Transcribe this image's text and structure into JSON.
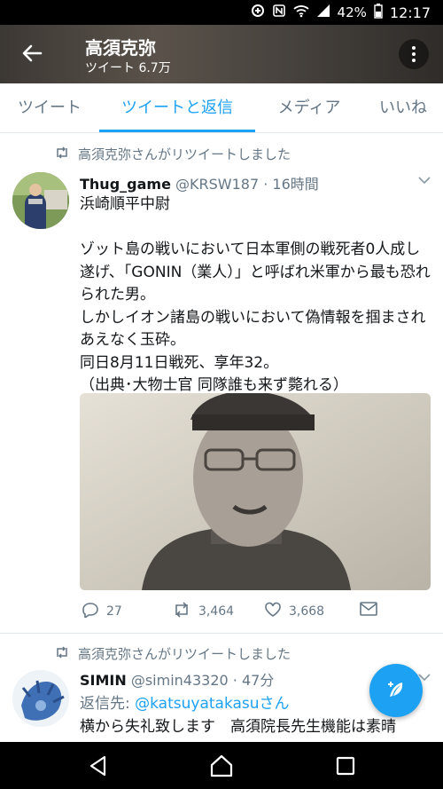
{
  "status_bar": {
    "battery": "42%",
    "time": "12:17",
    "icons": [
      "data-saver-icon",
      "nfc-icon",
      "wifi-icon",
      "signal-icon",
      "battery-icon"
    ]
  },
  "header": {
    "title": "高須克弥",
    "subtitle": "ツイート 6.7万",
    "back_icon": "arrow-left-icon",
    "more_icon": "more-vertical-icon"
  },
  "tabs": [
    {
      "label": "ツイート",
      "active": false
    },
    {
      "label": "ツイートと返信",
      "active": true
    },
    {
      "label": "メディア",
      "active": false
    },
    {
      "label": "いいね",
      "active": false
    }
  ],
  "tweets": [
    {
      "retweet_note": "高須克弥さんがリツイートしました",
      "author_name": "Thug_game",
      "meta": "@KRSW187 · 16時間",
      "text": "浜崎順平中尉\n\nゾット島の戦いにおいて日本軍側の戦死者0人成し遂げ、「GONIN（業人）」と呼ばれ米軍から最も恐れられた男。\nしかしイオン諸島の戦いにおいて偽情報を掴まされあえなく玉砕。\n同日8月11日戦死、享年32。\n（出典･大物士官 同隊誰も来ず斃れる）",
      "replies": "27",
      "retweets": "3,464",
      "likes": "3,668"
    },
    {
      "retweet_note": "高須克弥さんがリツイートしました",
      "author_name": "SIMIN",
      "meta": "@simin43320 · 47分",
      "reply_to_label": "返信先: ",
      "reply_to_handle": "@katsuyatakasuさん",
      "text": "横から失礼致します　高須院長先生機能は素晴"
    }
  ],
  "colors": {
    "accent": "#1da1f2",
    "text": "#14171a",
    "muted": "#657786"
  }
}
